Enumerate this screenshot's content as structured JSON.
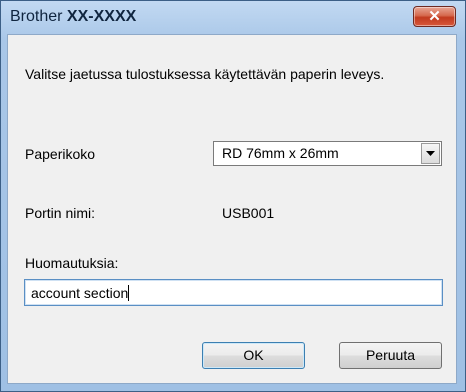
{
  "window": {
    "title_prefix": "Brother",
    "title_model": "XX-XXXX",
    "close_glyph": "✕"
  },
  "dialog": {
    "description": "Valitse jaetussa tulostuksessa käytettävän paperin leveys.",
    "paper_size": {
      "label": "Paperikoko",
      "selected": "RD 76mm x 26mm"
    },
    "port": {
      "label": "Portin nimi:",
      "value": "USB001"
    },
    "notes": {
      "label": "Huomautuksia:",
      "value": "account section"
    },
    "buttons": {
      "ok": "OK",
      "cancel": "Peruuta"
    }
  },
  "colors": {
    "frame": "#a9c7e8",
    "client_background": "#f0f0f0",
    "close_button": "#c13a1f"
  },
  "icons": {
    "close": "close-icon",
    "dropdown": "chevron-down-icon"
  }
}
